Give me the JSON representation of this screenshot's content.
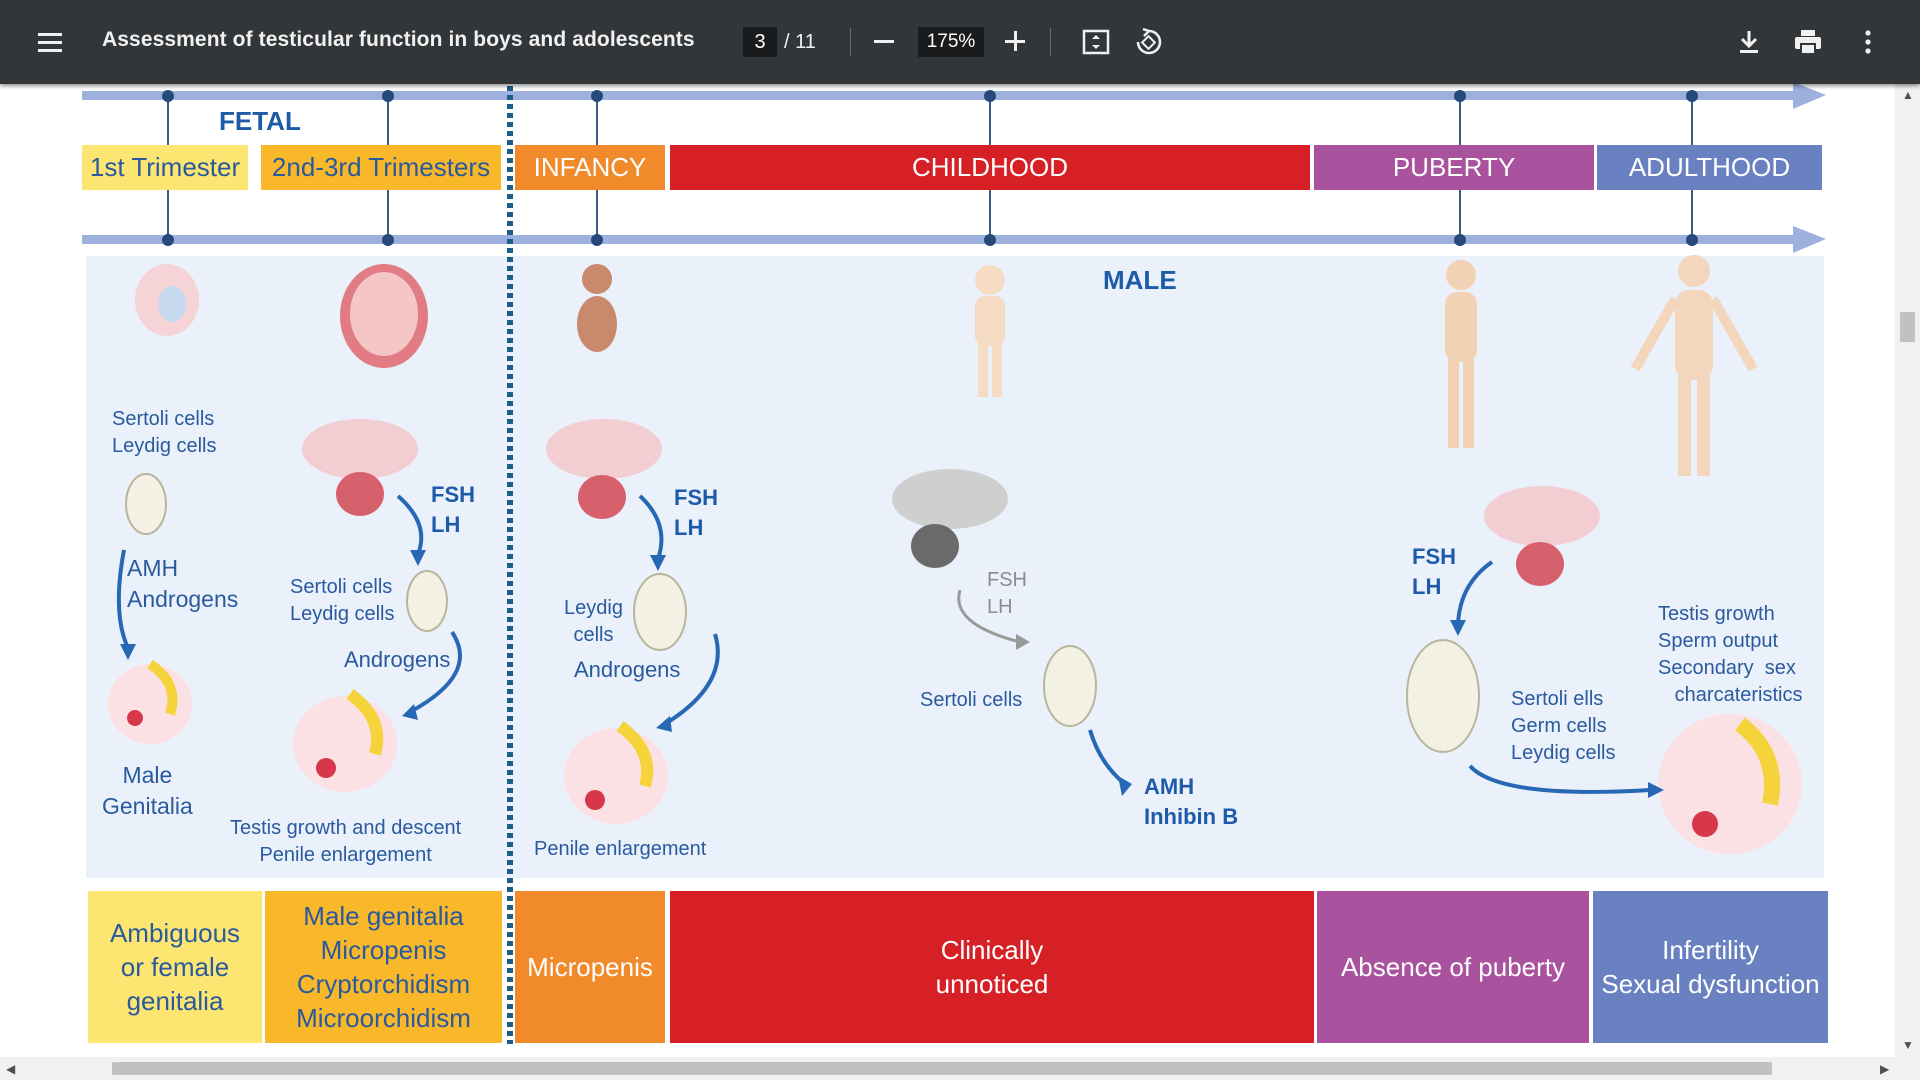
{
  "toolbar": {
    "title": "Assessment of testicular function in boys and adolescents",
    "page_current": "3",
    "page_total": "/ 11",
    "zoom": "175%"
  },
  "timeline": {
    "fetal_label": "FETAL",
    "male_label": "MALE",
    "stages": [
      {
        "label": "1st Trimester",
        "color": "#fde571"
      },
      {
        "label": "2nd-3rd Trimesters",
        "color": "#f9b72a"
      },
      {
        "label": "INFANCY",
        "color": "#f08a2a"
      },
      {
        "label": "CHILDHOOD",
        "color": "#d71f26"
      },
      {
        "label": "PUBERTY",
        "color": "#a9529e"
      },
      {
        "label": "ADULTHOOD",
        "color": "#6981c0"
      }
    ]
  },
  "labels": {
    "t1_cells": "Sertoli cells\nLeydig cells",
    "t1_hormones": "AMH\nAndrogens",
    "t1_outcome": "Male\nGenitalia",
    "t2_fsh": "FSH\nLH",
    "t2_cells": "Sertoli cells\nLeydig cells",
    "t2_androgens": "Androgens",
    "t2_outcome": "Testis growth and descent\nPenile enlargement",
    "inf_fsh": "FSH\nLH",
    "inf_cells": "Leydig\ncells",
    "inf_androgens": "Androgens",
    "inf_outcome": "Penile enlargement",
    "ch_fsh": "FSH\nLH",
    "ch_cells": "Sertoli cells",
    "ch_hormones": "AMH\nInhibin B",
    "pub_fsh": "FSH\nLH",
    "pub_cells": "Sertoli ells\nGerm cells\nLeydig cells",
    "adult_outcome": "Testis growth\nSperm output\nSecondary  sex\n   charcateristics"
  },
  "outcomes": [
    {
      "label": "Ambiguous\nor female\ngenitalia",
      "color": "#fde571",
      "text_color": "#2a5a9e"
    },
    {
      "label": "Male genitalia\nMicropenis\nCryptorchidism\nMicroorchidism",
      "color": "#f9b72a",
      "text_color": "#2a5a9e"
    },
    {
      "label": "Micropenis",
      "color": "#f08a2a",
      "text_color": "#ffffff"
    },
    {
      "label": "Clinically\nunnoticed",
      "color": "#d71f26",
      "text_color": "#ffffff"
    },
    {
      "label": "Absence of puberty",
      "color": "#a9529e",
      "text_color": "#ffffff"
    },
    {
      "label": "Infertility\nSexual dysfunction",
      "color": "#6981c0",
      "text_color": "#ffffff"
    }
  ],
  "icons": [
    "menu-icon",
    "zoom-out-icon",
    "zoom-in-icon",
    "fit-page-icon",
    "rotate-icon",
    "download-icon",
    "print-icon",
    "more-icon"
  ]
}
